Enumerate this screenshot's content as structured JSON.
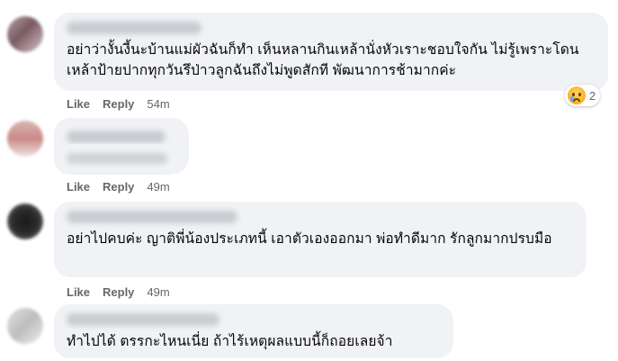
{
  "comments": [
    {
      "text": "อย่าว่างั้นงี้นะบ้านแม่ผัวฉันก็ทำ เห็นหลานกินเหล้านั่งหัวเราะชอบใจกัน ไม่รู้เพราะโดนเหล้าป้ายปากทุกวันรึป่าวลูกฉันถึงไม่พูดสักที พัฒนาการช้ามากค่ะ",
      "like": "Like",
      "reply": "Reply",
      "time": "54m",
      "reaction": {
        "icon": "sad-icon",
        "count": "2"
      }
    },
    {
      "text": "",
      "like": "Like",
      "reply": "Reply",
      "time": "49m"
    },
    {
      "text": "อย่าไปคบค่ะ ญาติพี่น้องประเภทนี้ เอาตัวเองออกมา พ่อทำดีมาก รักลูกมากปรบมือ",
      "like": "Like",
      "reply": "Reply",
      "time": "49m"
    },
    {
      "text": "ทำไปได้ ตรรกะไหนเนี่ย ถ้าไร้เหตุผลแบบนี้ก็ถอยเลยจ้า"
    }
  ],
  "colors": {
    "bubble": "#f0f2f5",
    "meta": "#65676b",
    "text": "#050505"
  }
}
